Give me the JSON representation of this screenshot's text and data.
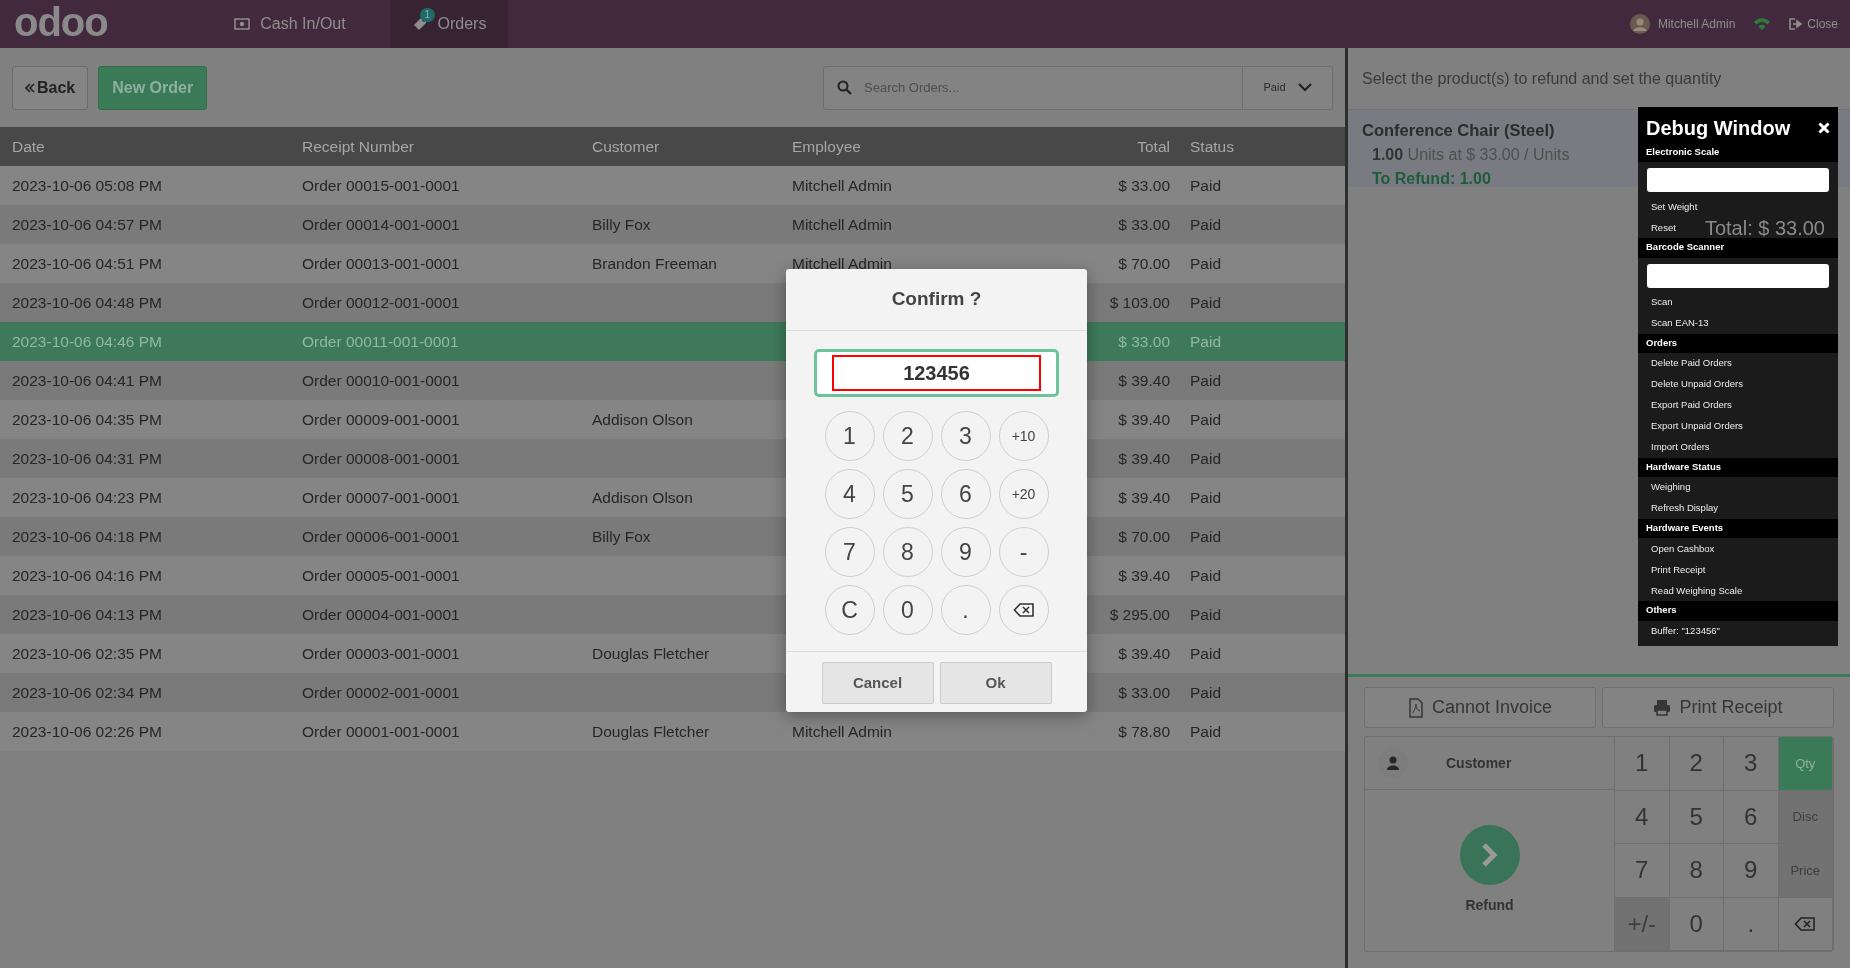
{
  "topbar": {
    "logo": "odoo",
    "tabs": [
      {
        "label": "Cash In/Out",
        "selected": false
      },
      {
        "label": "Orders",
        "badge": "1",
        "selected": true
      }
    ],
    "user": "Mitchell Admin",
    "close": "Close"
  },
  "toolbar": {
    "back": "Back",
    "new_order": "New Order",
    "search_placeholder": "Search Orders...",
    "filter": "Paid"
  },
  "table": {
    "columns": [
      "Date",
      "Receipt Number",
      "Customer",
      "Employee",
      "Total",
      "Status"
    ],
    "rows": [
      {
        "date": "2023-10-06 05:08 PM",
        "receipt": "Order 00015-001-0001",
        "employee": "Mitchell Admin",
        "total": "$ 33.00",
        "status": "Paid",
        "selected": false
      },
      {
        "date": "2023-10-06 04:57 PM",
        "receipt": "Order 00014-001-0001",
        "customer": "Billy Fox",
        "employee": "Mitchell Admin",
        "total": "$ 33.00",
        "status": "Paid",
        "selected": false
      },
      {
        "date": "2023-10-06 04:51 PM",
        "receipt": "Order 00013-001-0001",
        "customer": "Brandon Freeman",
        "employee": "Mitchell Admin",
        "total": "$ 70.00",
        "status": "Paid",
        "selected": false
      },
      {
        "date": "2023-10-06 04:48 PM",
        "receipt": "Order 00012-001-0001",
        "total": "$ 103.00",
        "status": "Paid",
        "selected": false
      },
      {
        "date": "2023-10-06 04:46 PM",
        "receipt": "Order 00011-001-0001",
        "total": "$ 33.00",
        "status": "Paid",
        "selected": true
      },
      {
        "date": "2023-10-06 04:41 PM",
        "receipt": "Order 00010-001-0001",
        "total": "$ 39.40",
        "status": "Paid",
        "selected": false
      },
      {
        "date": "2023-10-06 04:35 PM",
        "receipt": "Order 00009-001-0001",
        "customer": "Addison Olson",
        "total": "$ 39.40",
        "status": "Paid",
        "selected": false
      },
      {
        "date": "2023-10-06 04:31 PM",
        "receipt": "Order 00008-001-0001",
        "total": "$ 39.40",
        "status": "Paid",
        "selected": false
      },
      {
        "date": "2023-10-06 04:23 PM",
        "receipt": "Order 00007-001-0001",
        "customer": "Addison Olson",
        "total": "$ 39.40",
        "status": "Paid",
        "selected": false
      },
      {
        "date": "2023-10-06 04:18 PM",
        "receipt": "Order 00006-001-0001",
        "customer": "Billy Fox",
        "total": "$ 70.00",
        "status": "Paid",
        "selected": false
      },
      {
        "date": "2023-10-06 04:16 PM",
        "receipt": "Order 00005-001-0001",
        "total": "$ 39.40",
        "status": "Paid",
        "selected": false
      },
      {
        "date": "2023-10-06 04:13 PM",
        "receipt": "Order 00004-001-0001",
        "total": "$ 295.00",
        "status": "Paid",
        "selected": false
      },
      {
        "date": "2023-10-06 02:35 PM",
        "receipt": "Order 00003-001-0001",
        "customer": "Douglas Fletcher",
        "total": "$ 39.40",
        "status": "Paid",
        "selected": false
      },
      {
        "date": "2023-10-06 02:34 PM",
        "receipt": "Order 00002-001-0001",
        "total": "$ 33.00",
        "status": "Paid",
        "selected": false
      },
      {
        "date": "2023-10-06 02:26 PM",
        "receipt": "Order 00001-001-0001",
        "customer": "Douglas Fletcher",
        "employee": "Mitchell Admin",
        "total": "$ 78.80",
        "status": "Paid",
        "selected": false
      }
    ]
  },
  "refund": {
    "instruction": "Select the product(s) to refund and set the quantity",
    "line": {
      "product": "Conference Chair (Steel)",
      "quantity": "**1.00** Units at $ 33.00 / Units",
      "to_refund": "To Refund: 1.00"
    },
    "total": "Total: $ 33.00"
  },
  "actions": [
    {
      "label": "Cannot Invoice"
    },
    {
      "label": "Print Receipt"
    }
  ],
  "customer": "Customer",
  "payment": "Refund",
  "numpad": [
    {
      "label": "1",
      "kind": "digit",
      "disabled": false
    },
    {
      "label": "2",
      "kind": "digit",
      "disabled": false
    },
    {
      "label": "3",
      "kind": "digit",
      "disabled": false
    },
    {
      "label": "Qty",
      "kind": "mode",
      "selected": true,
      "disabled": false
    },
    {
      "label": "4",
      "kind": "digit",
      "disabled": false
    },
    {
      "label": "5",
      "kind": "digit",
      "disabled": false
    },
    {
      "label": "6",
      "kind": "digit",
      "disabled": false
    },
    {
      "label": "Disc",
      "kind": "mode",
      "selected": false,
      "disabled": true
    },
    {
      "label": "7",
      "kind": "digit",
      "disabled": false
    },
    {
      "label": "8",
      "kind": "digit",
      "disabled": false
    },
    {
      "label": "9",
      "kind": "digit",
      "disabled": false
    },
    {
      "label": "Price",
      "kind": "mode",
      "selected": false,
      "disabled": true
    },
    {
      "label": "+/-",
      "kind": "digit",
      "disabled": true
    },
    {
      "label": "0",
      "kind": "digit",
      "disabled": false
    },
    {
      "label": ".",
      "kind": "digit",
      "disabled": false
    },
    {
      "kind": "backspace",
      "disabled": false
    }
  ],
  "debug": {
    "title": "Debug Window",
    "sections": [
      {
        "title": "Electronic Scale",
        "items": [
          {
            "kind": "input"
          },
          {
            "kind": "action",
            "label": "Set Weight"
          },
          {
            "kind": "action",
            "label": "Reset"
          }
        ]
      },
      {
        "title": "Barcode Scanner",
        "items": [
          {
            "kind": "input"
          },
          {
            "kind": "action",
            "label": "Scan"
          },
          {
            "kind": "action",
            "label": "Scan EAN-13"
          }
        ]
      },
      {
        "title": "Orders",
        "items": [
          {
            "kind": "action",
            "label": "Delete Paid Orders"
          },
          {
            "kind": "action",
            "label": "Delete Unpaid Orders"
          },
          {
            "kind": "action",
            "label": "Export Paid Orders"
          },
          {
            "kind": "action",
            "label": "Export Unpaid Orders"
          },
          {
            "kind": "action",
            "label": "Import Orders"
          }
        ]
      },
      {
        "title": "Hardware Status",
        "items": [
          {
            "kind": "action",
            "label": "Weighing"
          },
          {
            "kind": "action",
            "label": "Refresh Display"
          }
        ]
      },
      {
        "title": "Hardware Events",
        "items": [
          {
            "kind": "action",
            "label": "Open Cashbox"
          },
          {
            "kind": "action",
            "label": "Print Receipt"
          },
          {
            "kind": "action",
            "label": "Read Weighing Scale"
          }
        ]
      },
      {
        "title": "Others",
        "items": [
          {
            "kind": "text",
            "label": "Buffer: \"123456\""
          }
        ]
      }
    ]
  },
  "dialog": {
    "title": "Confirm ?",
    "value": "123456",
    "keys": [
      {
        "label": "1",
        "kind": "key"
      },
      {
        "label": "2",
        "kind": "key"
      },
      {
        "label": "3",
        "kind": "key"
      },
      {
        "label": "+10",
        "kind": "small"
      },
      {
        "label": "4",
        "kind": "key"
      },
      {
        "label": "5",
        "kind": "key"
      },
      {
        "label": "6",
        "kind": "key"
      },
      {
        "label": "+20",
        "kind": "small"
      },
      {
        "label": "7",
        "kind": "key"
      },
      {
        "label": "8",
        "kind": "key"
      },
      {
        "label": "9",
        "kind": "key"
      },
      {
        "label": "-",
        "kind": "key"
      },
      {
        "label": "C",
        "kind": "key"
      },
      {
        "label": "0",
        "kind": "key"
      },
      {
        "label": ".",
        "kind": "key"
      },
      {
        "kind": "backspace"
      }
    ],
    "buttons": [
      "Cancel",
      "Ok"
    ]
  }
}
